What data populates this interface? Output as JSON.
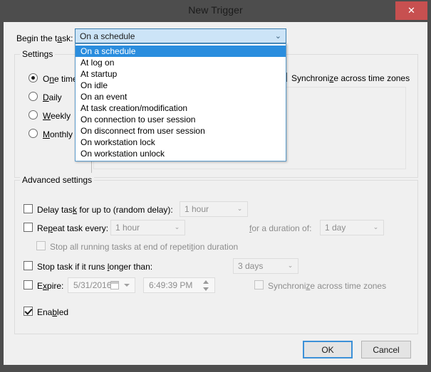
{
  "window": {
    "title": "New Trigger",
    "close_label": "✕",
    "close_icon": "close-icon"
  },
  "colors": {
    "titlebar_bg": "#4d4d4d",
    "close_btn": "#c75050",
    "client_bg": "#f0f0f0",
    "dropdown_selected": "#2a8dde",
    "combo_focus_bg": "#cce4f7",
    "combo_focus_border": "#3c7fb1",
    "default_button_border": "#3c91d8"
  },
  "begin_task": {
    "label": "Begin the task:",
    "label_pre": "Begin the t",
    "label_accel": "a",
    "label_post": "sk:",
    "selected": "On a schedule",
    "expanded": true,
    "chevron": "⌄",
    "options": [
      "On a schedule",
      "At log on",
      "At startup",
      "On idle",
      "On an event",
      "At task creation/modification",
      "On connection to user session",
      "On disconnect from user session",
      "On workstation lock",
      "On workstation unlock"
    ]
  },
  "settings": {
    "title": "Settings",
    "selected": "One time",
    "options": [
      {
        "label": "One time",
        "pre": "O",
        "accel": "n",
        "post": "e time",
        "checked": true
      },
      {
        "label": "Daily",
        "pre": "",
        "accel": "D",
        "post": "aily",
        "checked": false
      },
      {
        "label": "Weekly",
        "pre": "",
        "accel": "W",
        "post": "eekly",
        "checked": false
      },
      {
        "label": "Monthly",
        "pre": "",
        "accel": "M",
        "post": "onthly",
        "checked": false
      }
    ],
    "sync_time_zones": {
      "label": "Synchronize across time zones",
      "pre": "Synchroni",
      "accel": "z",
      "post": "e across time zones",
      "checked": false
    }
  },
  "advanced": {
    "title": "Advanced settings",
    "delay_task": {
      "label": "Delay task for up to (random delay):",
      "pre": "Delay tas",
      "accel": "k",
      "post": " for up to (random delay):",
      "checked": false,
      "value": "1 hour",
      "chevron": "⌄"
    },
    "repeat_task": {
      "label": "Repeat task every:",
      "pre": "Re",
      "accel": "p",
      "post": "eat task every:",
      "checked": false,
      "value": "1 hour",
      "chevron": "⌄"
    },
    "duration": {
      "label": "for a duration of:",
      "pre": "",
      "accel": "f",
      "post": "or a duration of:",
      "value": "1 day",
      "chevron": "⌄"
    },
    "stop_all_running": {
      "label": "Stop all running tasks at end of repetition duration",
      "pre": "Stop all running tasks at end of repeti",
      "accel": "t",
      "post": "ion duration",
      "checked": false
    },
    "stop_if_longer": {
      "label": "Stop task if it runs longer than:",
      "pre": "Stop task if it runs ",
      "accel": "l",
      "post": "onger than:",
      "checked": false,
      "value": "3 days",
      "chevron": "⌄"
    },
    "expire": {
      "label": "Expire:",
      "pre": "E",
      "accel": "x",
      "post": "pire:",
      "checked": false,
      "date": "5/31/2016",
      "time": "6:49:39 PM",
      "calendar_icon": "calendar-icon",
      "spinner_icon": "spinner-icon"
    },
    "sync_time_zones": {
      "label": "Synchronize across time zones",
      "pre": "Synchroni",
      "accel": "z",
      "post": "e across time zones",
      "checked": false,
      "enabled": false
    },
    "enabled": {
      "label": "Enabled",
      "pre": "Ena",
      "accel": "b",
      "post": "led",
      "checked": true
    }
  },
  "footer": {
    "ok": "OK",
    "cancel": "Cancel"
  }
}
